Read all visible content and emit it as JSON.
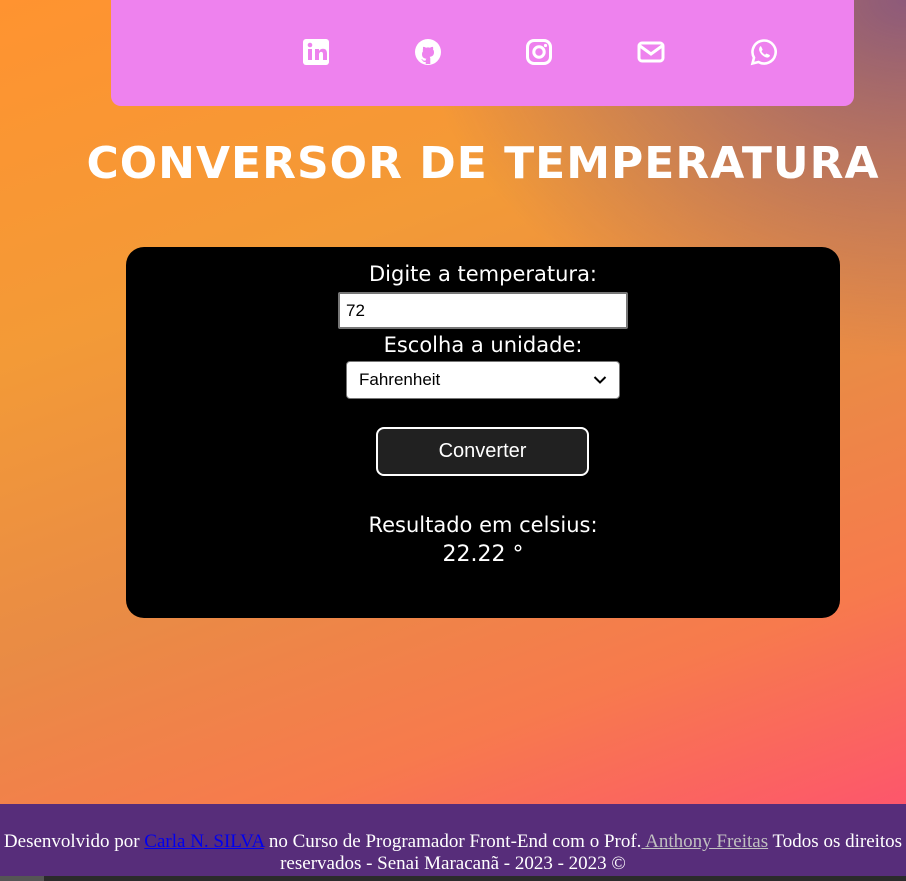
{
  "social": {
    "icons": [
      "linkedin-icon",
      "github-icon",
      "instagram-icon",
      "envelope-icon",
      "whatsapp-icon"
    ],
    "background": "#ee82ee"
  },
  "title": "CONVERSOR DE TEMPERATURA",
  "form": {
    "temperature_label": "Digite a temperatura:",
    "temperature_value": "72",
    "unit_label": "Escolha a unidade:",
    "unit_selected": "Fahrenheit",
    "convert_label": "Converter"
  },
  "result": {
    "label": "Resultado em celsius:",
    "value": "22.22 °"
  },
  "footer": {
    "prefix": "Desenvolvido por ",
    "author": "Carla N. SILVA",
    "middle": " no Curso de Programador Front-End com o Prof.",
    "professor": " Anthony Freitas",
    "suffix": " Todos os direitos reservados - Senai Maracanã - 2023 - 2023 ©"
  },
  "colors": {
    "card": "#000000",
    "footer": "#572d7a",
    "author_link": "#0000ee"
  }
}
